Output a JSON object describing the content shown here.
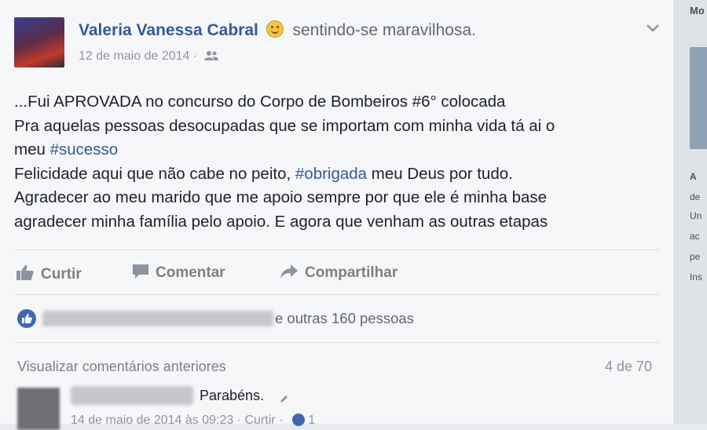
{
  "post": {
    "author_name": "Valeria Vanessa Cabral",
    "feeling": "sentindo-se maravilhosa.",
    "date": "12 de maio de 2014",
    "separator": "·",
    "audience_icon": "friends-icon",
    "lines": [
      [
        {
          "t": "...Fui APROVADA no concurso do Corpo de Bombeiros #6° colocada"
        }
      ],
      [
        {
          "t": "Pra aquelas pessoas desocupadas que se importam com minha vida tá ai o"
        }
      ],
      [
        {
          "t": "meu "
        },
        {
          "t": "#sucesso",
          "tag": true
        }
      ],
      [
        {
          "t": "Felicidade aqui que não cabe no peito, "
        },
        {
          "t": "#obrigada",
          "tag": true
        },
        {
          "t": " meu Deus por tudo."
        }
      ],
      [
        {
          "t": "Agradecer ao meu marido que me apoio sempre por que ele é minha base"
        }
      ],
      [
        {
          "t": "agradecer minha família pelo apoio. E agora que venham as outras etapas"
        }
      ]
    ]
  },
  "actions": {
    "like": "Curtir",
    "comment": "Comentar",
    "share": "Compartilhar"
  },
  "likes": {
    "text": "e outras 160 pessoas"
  },
  "comments": {
    "view_previous": "Visualizar comentários anteriores",
    "count": "4 de 70",
    "first": {
      "text": "Parabéns.",
      "meta": "14 de maio de 2014 às 09:23 · Curtir ·",
      "like_count": "1"
    }
  },
  "right_column": {
    "top_label": "Mo",
    "lines": [
      "A",
      "de",
      "Un",
      "ac",
      "pe",
      "Ins"
    ]
  },
  "colors": {
    "link": "#365899",
    "muted": "#90949c",
    "like_badge": "#4267b2",
    "card_bg": "#f6f7f9"
  }
}
